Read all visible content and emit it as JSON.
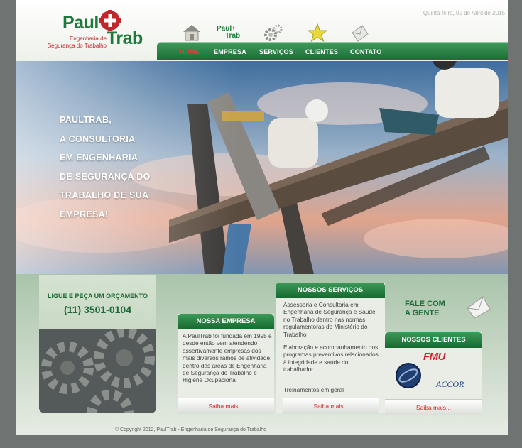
{
  "header": {
    "logo": {
      "name_part1": "Paul",
      "name_part2": "Trab",
      "tagline_line1": "Engenharia de",
      "tagline_line2": "Segurança do Trabalho"
    },
    "date": "Quinta-feira, 02 de Abril de 2015",
    "nav_icons": [
      "home-icon",
      "logo-icon",
      "gear-icon",
      "star-icon",
      "envelope-icon"
    ],
    "nav": [
      {
        "label": "HOME",
        "active": true
      },
      {
        "label": "EMPRESA",
        "active": false
      },
      {
        "label": "SERVIÇOS",
        "active": false
      },
      {
        "label": "CLIENTES",
        "active": false
      },
      {
        "label": "CONTATO",
        "active": false
      }
    ]
  },
  "hero": {
    "lines": [
      "PAULTRAB,",
      "A CONSULTORIA",
      "EM ENGENHARIA",
      "DE SEGURANÇA DO",
      "TRABALHO DE SUA",
      "EMPRESA!"
    ]
  },
  "phone": {
    "label": "LIGUE E PEÇA UM ORÇAMENTO",
    "number": "(11) 3501-0104"
  },
  "empresa": {
    "title": "NOSSA EMPRESA",
    "text": "A PaulTrab foi fundada em 1995 e desde então vem atendendo assertivamente empresas dos mais diversos ramos de atividade, dentro das áreas de Engenharia de Segurança do Trabalho e Higiene Ocupacional",
    "more": "Saiba mais..."
  },
  "servicos": {
    "title": "NOSSOS SERVIÇOS",
    "items": [
      "Assessoria e Consultoria em Engenharia de Segurança e Saúde no Trabalho dentro nas normas regulamentoras do Ministério do Trabalho",
      "Elaboração e acompanhamento dos programas preventivos relacionados à integridade e saúde do trabalhador",
      "Treinamentos em geral"
    ],
    "more": "Saiba mais..."
  },
  "fale": {
    "line1": "FALE COM",
    "line2": "A GENTE"
  },
  "clientes": {
    "title": "NOSSOS CLIENTES",
    "logos": [
      "FMU",
      "ACCOR"
    ],
    "more": "Saiba mais..."
  },
  "footer": {
    "text": "© Copyright 2012, PaulTrab - Engenharia de Segurança do Trabalho"
  },
  "colors": {
    "green": "#1e7a3a",
    "red": "#c0272d",
    "nav_active": "#e53b3b"
  }
}
